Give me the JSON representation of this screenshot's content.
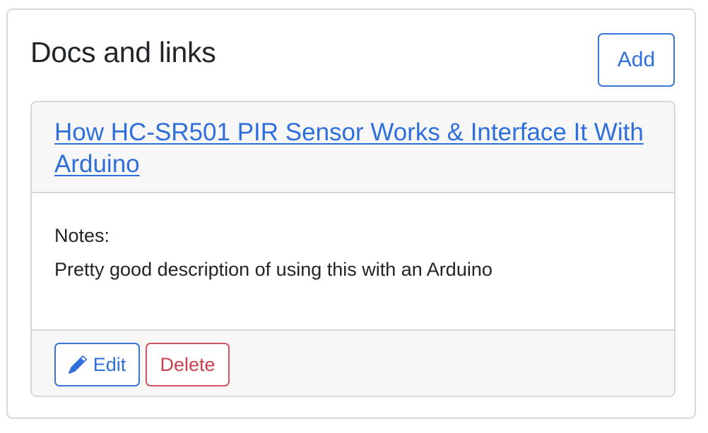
{
  "panel": {
    "title": "Docs and links",
    "add_label": "Add"
  },
  "card": {
    "link_text": "How HC-SR501 PIR Sensor Works & Interface It With Arduino",
    "notes_label": "Notes:",
    "notes_text": "Pretty good description of using this with an Arduino",
    "edit_label": "Edit",
    "edit_icon": "pencil-icon",
    "delete_label": "Delete"
  },
  "colors": {
    "primary": "#2f6fdb",
    "danger": "#c8414f",
    "border": "#d7d7d7",
    "header_bg": "#f7f7f7"
  }
}
